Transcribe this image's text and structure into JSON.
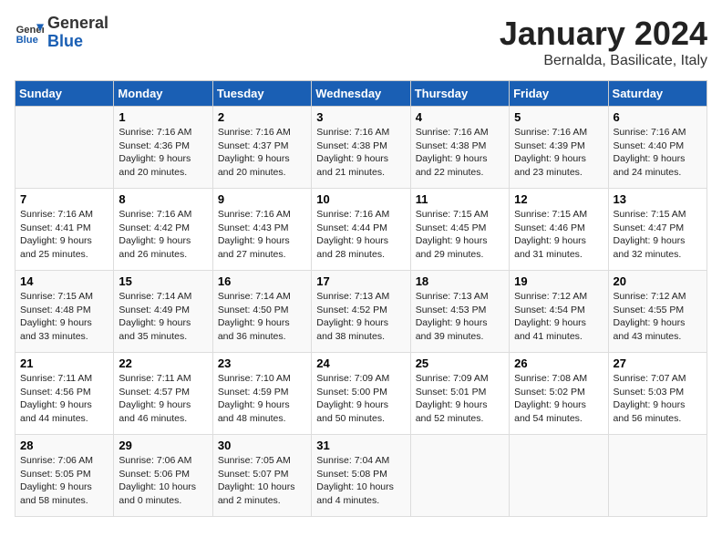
{
  "header": {
    "logo_line1": "General",
    "logo_line2": "Blue",
    "month_title": "January 2024",
    "subtitle": "Bernalda, Basilicate, Italy"
  },
  "days_of_week": [
    "Sunday",
    "Monday",
    "Tuesday",
    "Wednesday",
    "Thursday",
    "Friday",
    "Saturday"
  ],
  "weeks": [
    [
      {
        "day": "",
        "info": ""
      },
      {
        "day": "1",
        "info": "Sunrise: 7:16 AM\nSunset: 4:36 PM\nDaylight: 9 hours\nand 20 minutes."
      },
      {
        "day": "2",
        "info": "Sunrise: 7:16 AM\nSunset: 4:37 PM\nDaylight: 9 hours\nand 20 minutes."
      },
      {
        "day": "3",
        "info": "Sunrise: 7:16 AM\nSunset: 4:38 PM\nDaylight: 9 hours\nand 21 minutes."
      },
      {
        "day": "4",
        "info": "Sunrise: 7:16 AM\nSunset: 4:38 PM\nDaylight: 9 hours\nand 22 minutes."
      },
      {
        "day": "5",
        "info": "Sunrise: 7:16 AM\nSunset: 4:39 PM\nDaylight: 9 hours\nand 23 minutes."
      },
      {
        "day": "6",
        "info": "Sunrise: 7:16 AM\nSunset: 4:40 PM\nDaylight: 9 hours\nand 24 minutes."
      }
    ],
    [
      {
        "day": "7",
        "info": "Sunrise: 7:16 AM\nSunset: 4:41 PM\nDaylight: 9 hours\nand 25 minutes."
      },
      {
        "day": "8",
        "info": "Sunrise: 7:16 AM\nSunset: 4:42 PM\nDaylight: 9 hours\nand 26 minutes."
      },
      {
        "day": "9",
        "info": "Sunrise: 7:16 AM\nSunset: 4:43 PM\nDaylight: 9 hours\nand 27 minutes."
      },
      {
        "day": "10",
        "info": "Sunrise: 7:16 AM\nSunset: 4:44 PM\nDaylight: 9 hours\nand 28 minutes."
      },
      {
        "day": "11",
        "info": "Sunrise: 7:15 AM\nSunset: 4:45 PM\nDaylight: 9 hours\nand 29 minutes."
      },
      {
        "day": "12",
        "info": "Sunrise: 7:15 AM\nSunset: 4:46 PM\nDaylight: 9 hours\nand 31 minutes."
      },
      {
        "day": "13",
        "info": "Sunrise: 7:15 AM\nSunset: 4:47 PM\nDaylight: 9 hours\nand 32 minutes."
      }
    ],
    [
      {
        "day": "14",
        "info": "Sunrise: 7:15 AM\nSunset: 4:48 PM\nDaylight: 9 hours\nand 33 minutes."
      },
      {
        "day": "15",
        "info": "Sunrise: 7:14 AM\nSunset: 4:49 PM\nDaylight: 9 hours\nand 35 minutes."
      },
      {
        "day": "16",
        "info": "Sunrise: 7:14 AM\nSunset: 4:50 PM\nDaylight: 9 hours\nand 36 minutes."
      },
      {
        "day": "17",
        "info": "Sunrise: 7:13 AM\nSunset: 4:52 PM\nDaylight: 9 hours\nand 38 minutes."
      },
      {
        "day": "18",
        "info": "Sunrise: 7:13 AM\nSunset: 4:53 PM\nDaylight: 9 hours\nand 39 minutes."
      },
      {
        "day": "19",
        "info": "Sunrise: 7:12 AM\nSunset: 4:54 PM\nDaylight: 9 hours\nand 41 minutes."
      },
      {
        "day": "20",
        "info": "Sunrise: 7:12 AM\nSunset: 4:55 PM\nDaylight: 9 hours\nand 43 minutes."
      }
    ],
    [
      {
        "day": "21",
        "info": "Sunrise: 7:11 AM\nSunset: 4:56 PM\nDaylight: 9 hours\nand 44 minutes."
      },
      {
        "day": "22",
        "info": "Sunrise: 7:11 AM\nSunset: 4:57 PM\nDaylight: 9 hours\nand 46 minutes."
      },
      {
        "day": "23",
        "info": "Sunrise: 7:10 AM\nSunset: 4:59 PM\nDaylight: 9 hours\nand 48 minutes."
      },
      {
        "day": "24",
        "info": "Sunrise: 7:09 AM\nSunset: 5:00 PM\nDaylight: 9 hours\nand 50 minutes."
      },
      {
        "day": "25",
        "info": "Sunrise: 7:09 AM\nSunset: 5:01 PM\nDaylight: 9 hours\nand 52 minutes."
      },
      {
        "day": "26",
        "info": "Sunrise: 7:08 AM\nSunset: 5:02 PM\nDaylight: 9 hours\nand 54 minutes."
      },
      {
        "day": "27",
        "info": "Sunrise: 7:07 AM\nSunset: 5:03 PM\nDaylight: 9 hours\nand 56 minutes."
      }
    ],
    [
      {
        "day": "28",
        "info": "Sunrise: 7:06 AM\nSunset: 5:05 PM\nDaylight: 9 hours\nand 58 minutes."
      },
      {
        "day": "29",
        "info": "Sunrise: 7:06 AM\nSunset: 5:06 PM\nDaylight: 10 hours\nand 0 minutes."
      },
      {
        "day": "30",
        "info": "Sunrise: 7:05 AM\nSunset: 5:07 PM\nDaylight: 10 hours\nand 2 minutes."
      },
      {
        "day": "31",
        "info": "Sunrise: 7:04 AM\nSunset: 5:08 PM\nDaylight: 10 hours\nand 4 minutes."
      },
      {
        "day": "",
        "info": ""
      },
      {
        "day": "",
        "info": ""
      },
      {
        "day": "",
        "info": ""
      }
    ]
  ]
}
